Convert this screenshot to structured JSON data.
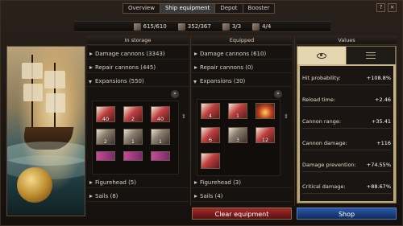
{
  "tabs": [
    {
      "label": "Overview",
      "active": false
    },
    {
      "label": "Ship equipment",
      "active": true
    },
    {
      "label": "Depot",
      "active": false
    },
    {
      "label": "Booster",
      "active": false
    }
  ],
  "stats": {
    "cannons": "615/610",
    "cargo": "352/367",
    "slot_a": "3/3",
    "slot_b": "4/4"
  },
  "columns": {
    "storage": "In storage",
    "equipped": "Equipped",
    "values": "Values"
  },
  "storage": {
    "damage_cannons": "Damage cannons (3343)",
    "repair_cannons": "Repair cannons (445)",
    "expansions": "Expansions (550)",
    "figurehead": "Figurehead (5)",
    "sails": "Sails (8)",
    "items": [
      "40",
      "2",
      "40",
      "2",
      "1",
      "1",
      "",
      "",
      ""
    ]
  },
  "equipped": {
    "damage_cannons": "Damage cannons (610)",
    "repair_cannons": "Repair cannons (0)",
    "expansions": "Expansions (30)",
    "figurehead": "Figurehead (3)",
    "sails": "Sails (4)",
    "items": [
      "4",
      "1",
      "",
      "6",
      "3",
      "12",
      ""
    ]
  },
  "values": [
    {
      "label": "Hit probability:",
      "value": "+108.8%"
    },
    {
      "label": "Reload time:",
      "value": "+2.46"
    },
    {
      "label": "Cannon range:",
      "value": "+35.41"
    },
    {
      "label": "Cannon damage:",
      "value": "+116"
    },
    {
      "label": "Damage prevention:",
      "value": "+74.55%"
    },
    {
      "label": "Critical damage:",
      "value": "+88.67%"
    }
  ],
  "buttons": {
    "clear": "Clear equipment",
    "shop": "Shop"
  },
  "icons": {
    "help": "?",
    "close": "×",
    "nav": "»"
  }
}
